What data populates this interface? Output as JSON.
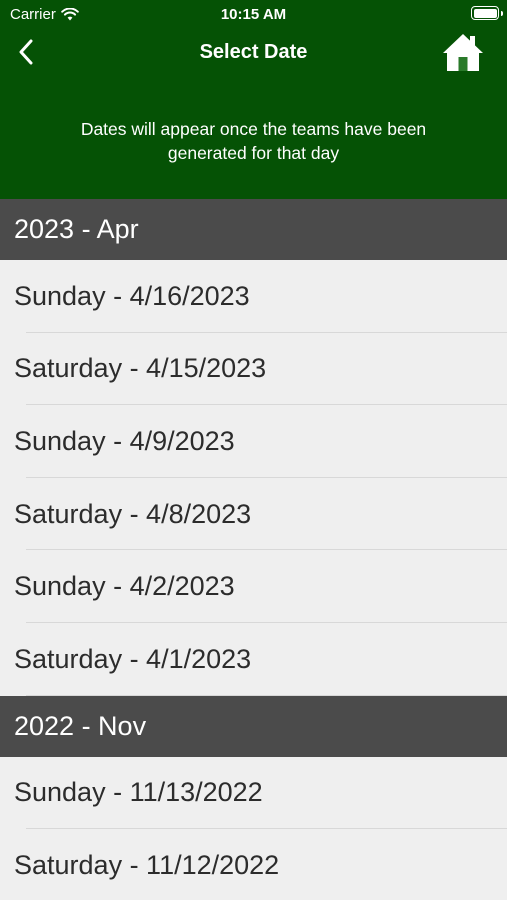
{
  "status_bar": {
    "carrier": "Carrier",
    "time": "10:15 AM"
  },
  "nav": {
    "title": "Select Date",
    "back_icon": "chevron-left-icon",
    "home_icon": "home-icon"
  },
  "info_text": "Dates will appear once the teams have been generated for that day",
  "colors": {
    "header_bg": "#055205",
    "section_bg": "#4b4b4b",
    "list_bg": "#efefef"
  },
  "sections": [
    {
      "title": "2023 - Apr",
      "dates": [
        "Sunday - 4/16/2023",
        "Saturday - 4/15/2023",
        "Sunday - 4/9/2023",
        "Saturday - 4/8/2023",
        "Sunday - 4/2/2023",
        "Saturday - 4/1/2023"
      ]
    },
    {
      "title": "2022 - Nov",
      "dates": [
        "Sunday - 11/13/2022",
        "Saturday - 11/12/2022"
      ]
    }
  ]
}
